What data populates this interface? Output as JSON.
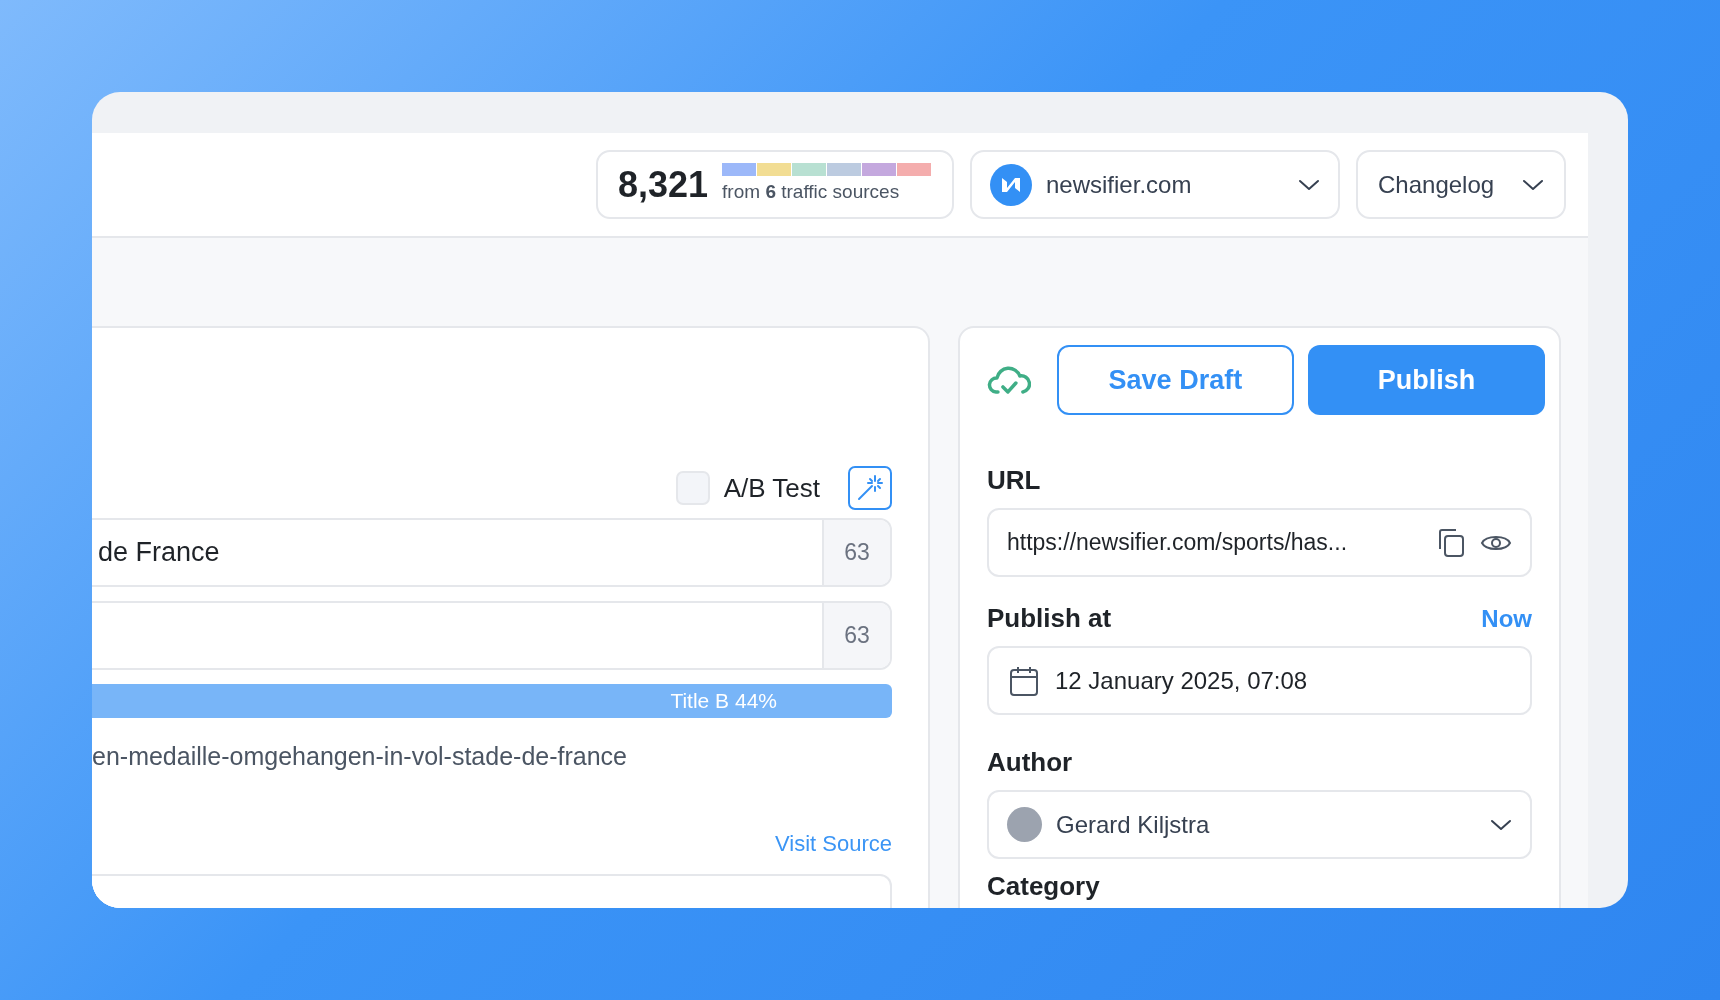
{
  "traffic": {
    "count": "8,321",
    "summary": "from **6** traffic sources",
    "sources": [
      {
        "color": "#9cb8f9"
      },
      {
        "color": "#f2dd93"
      },
      {
        "color": "#b8e0d2"
      },
      {
        "color": "#bccbe0"
      },
      {
        "color": "#c4a8de"
      },
      {
        "color": "#f4adad"
      }
    ]
  },
  "site_selector": {
    "label": "newsifier.com"
  },
  "changelog": {
    "label": "Changelog"
  },
  "editor": {
    "ab_test": {
      "label": "A/B Test",
      "checked": false
    },
    "titles": [
      {
        "value": "de France",
        "count": "63"
      },
      {
        "count": "63"
      }
    ],
    "variant_bar": {
      "label": "Title B 44%"
    },
    "slug": "en-medaille-omgehangen-in-vol-stade-de-france",
    "visit_source": "Visit Source"
  },
  "publish_panel": {
    "save_draft": "Save Draft",
    "publish": "Publish",
    "url": {
      "label": "URL",
      "value": "https://newsifier.com/sports/has..."
    },
    "publish_at": {
      "label": "Publish at",
      "now": "Now",
      "value": "12 January 2025, 07:08"
    },
    "author": {
      "label": "Author",
      "value": "Gerard Kiljstra"
    },
    "category": {
      "label": "Category"
    }
  }
}
